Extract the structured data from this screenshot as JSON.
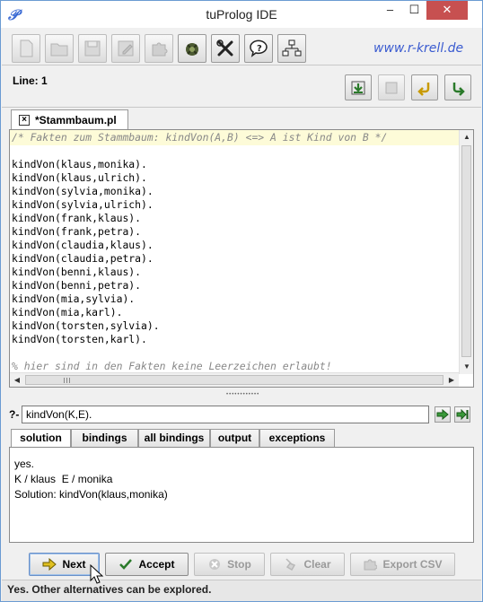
{
  "window": {
    "title": "tuProlog IDE"
  },
  "toolbar": {
    "link_text": "www.r-krell.de",
    "buttons": [
      {
        "icon": "new-file-icon",
        "enabled": false
      },
      {
        "icon": "open-folder-icon",
        "enabled": false
      },
      {
        "icon": "save-icon",
        "enabled": false
      },
      {
        "icon": "save-as-icon",
        "enabled": false
      },
      {
        "icon": "puzzle-icon",
        "enabled": false
      },
      {
        "icon": "library-icon",
        "enabled": true
      },
      {
        "icon": "tools-icon",
        "enabled": true
      },
      {
        "icon": "help-icon",
        "enabled": true
      },
      {
        "icon": "network-icon",
        "enabled": true
      }
    ]
  },
  "status_line": {
    "label": "Line: 1"
  },
  "editor": {
    "tab_title": "*Stammbaum.pl",
    "lines": [
      {
        "text": "/* Fakten zum Stammbaum: kindVon(A,B) <=> A ist Kind von B */",
        "comment": true
      },
      {
        "text": "",
        "comment": false
      },
      {
        "text": "kindVon(klaus,monika).",
        "comment": false
      },
      {
        "text": "kindVon(klaus,ulrich).",
        "comment": false
      },
      {
        "text": "kindVon(sylvia,monika).",
        "comment": false
      },
      {
        "text": "kindVon(sylvia,ulrich).",
        "comment": false
      },
      {
        "text": "kindVon(frank,klaus).",
        "comment": false
      },
      {
        "text": "kindVon(frank,petra).",
        "comment": false
      },
      {
        "text": "kindVon(claudia,klaus).",
        "comment": false
      },
      {
        "text": "kindVon(claudia,petra).",
        "comment": false
      },
      {
        "text": "kindVon(benni,klaus).",
        "comment": false
      },
      {
        "text": "kindVon(benni,petra).",
        "comment": false
      },
      {
        "text": "kindVon(mia,sylvia).",
        "comment": false
      },
      {
        "text": "kindVon(mia,karl).",
        "comment": false
      },
      {
        "text": "kindVon(torsten,sylvia).",
        "comment": false
      },
      {
        "text": "kindVon(torsten,karl).",
        "comment": false
      },
      {
        "text": "",
        "comment": false
      },
      {
        "text": "% hier sind in den Fakten keine Leerzeichen erlaubt!",
        "comment": true
      }
    ]
  },
  "query": {
    "prefix": "?-",
    "value": "kindVon(K,E)."
  },
  "result_tabs": [
    "solution",
    "bindings",
    "all bindings",
    "output",
    "exceptions"
  ],
  "active_result_tab": "solution",
  "results": {
    "lines": [
      "yes.",
      "K / klaus  E / monika",
      "Solution: kindVon(klaus,monika)"
    ]
  },
  "buttons": {
    "next": "Next",
    "accept": "Accept",
    "stop": "Stop",
    "clear": "Clear",
    "export": "Export CSV"
  },
  "statusbar": {
    "text": "Yes. Other alternatives can be explored."
  },
  "colors": {
    "link": "#3a5bd0",
    "comment_line_bg": "#fdfbd8",
    "close_button": "#c75050"
  }
}
